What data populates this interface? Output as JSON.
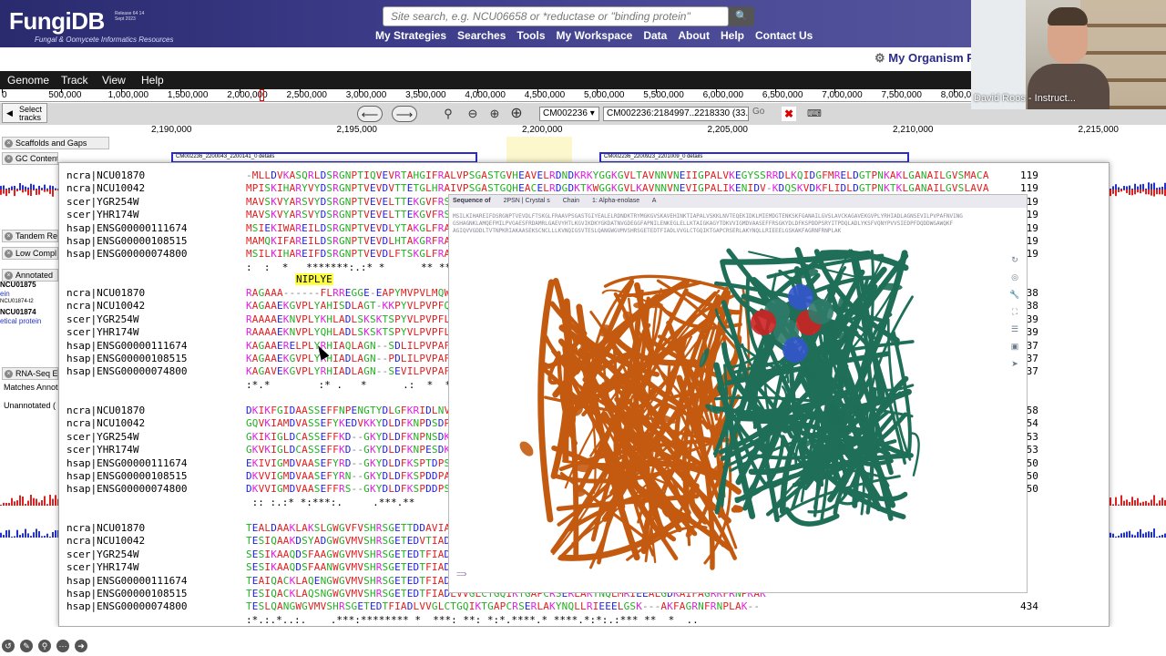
{
  "app": {
    "name": "FungiDB",
    "subtitle": "Fungal & Oomycete Informatics Resources",
    "release": "Release 64 14 Sept 2023"
  },
  "search": {
    "placeholder": "Site search, e.g. NCU06658 or *reductase or \"binding protein\""
  },
  "nav": [
    "My Strategies",
    "Searches",
    "Tools",
    "My Workspace",
    "Data",
    "About",
    "Help",
    "Contact Us"
  ],
  "my_organism": "My Organism P",
  "video": {
    "presenter": "David Roos - Instruct..."
  },
  "browser": {
    "menu": [
      "Genome",
      "Track",
      "View",
      "Help"
    ],
    "ruler": [
      "0",
      "500,000",
      "1,000,000",
      "1,500,000",
      "2,000,000",
      "2,500,000",
      "3,000,000",
      "3,500,000",
      "4,000,000",
      "4,500,000",
      "5,000,000",
      "5,500,000",
      "6,000,000",
      "6,500,000",
      "7,000,000",
      "7,500,000",
      "8,000,000"
    ],
    "select_tracks": "Select tracks",
    "ref_seq": "CM002236",
    "location": "CM002236:2184997..2218330 (33.33 Kb)",
    "go": "Go",
    "coords": [
      "2,190,000",
      "2,195,000",
      "2,200,000",
      "2,205,000",
      "2,210,000",
      "2,215,000"
    ],
    "tracks": [
      "Scaffolds and Gaps",
      "GC Content",
      "Tandem Re",
      "Low Compl",
      "Annotated",
      "RNA-Seq Ev",
      "Matches Annot",
      "Unannotated ("
    ],
    "features": [
      "CM002236_2200043_2200141_0 details",
      "CM002236_2200923_2201009_0 details"
    ],
    "gene_labels": [
      "NCU01875",
      "ein",
      "NCU01874-t2",
      "NCU01874",
      "etical protein"
    ]
  },
  "alignment": {
    "motif": "NIPLYE",
    "blocks": [
      {
        "rows": [
          {
            "name": "ncra|NCU01870",
            "seq": "-MLLDVKASQRLDSRGNPTIQVEVRTAHGIFRALVPSGASTGVHEAVELRDNDKRKYGGKGVLTAVNNVNEIIGPALVKEGYSSRRDLKQIDGFMRELDGTPNKAKLGANAILGVSMACA",
            "num": "119"
          },
          {
            "name": "ncra|NCU10042",
            "seq": "MPISKIHARYVYDSRGNPTVEVDVTTETGLHRAIVPSGASTGQHEACELRDGDKTKWGGKGVLKAVNNVNEVIGPALIKENIDV-KDQSKVDKFLIDLDGTPNKTKLGANAILGVSLAVA",
            "num": "119"
          },
          {
            "name": "scer|YGR254W",
            "seq": "MAVSKVYARSVYDSRGNPTVEVELTTEKGVFRSIVPSGASTGVHEALEMRDEDKSKWMGKGVMNAVNNVNNVIAAAFVKANLDVKDQKAVDDFLLSLDGTANKSKLGANAILGVSLAAS",
            "num": "119"
          },
          {
            "name": "scer|YHR174W",
            "seq": "MAVSKVYARSVYDSRGNPTVEVELTTEKGVFRSIVPSGASTGVHEALEMRDGDKSKWMGKGVLHAVKNVNDVIAPAFVKANIDVKDQKAVDDFLISLDGTANKSKLGANAILGVSMAAA",
            "num": "119"
          },
          {
            "name": "hsap|ENSG00000111674",
            "seq": "MSIEKIWAREILDSRGNPTVEVDLYTAKGLFRAAVPSGASTGIYEALELRDGDKQRYLGKGVLKAVDHINSTIAPALISSGLSVVEQEKLDNLMLELDGTENKSKFGANAILGVSLAVC",
            "num": "119"
          },
          {
            "name": "hsap|ENSG00000108515",
            "seq": "MAMQKIFAREILDSRGNPTVEVDLHTAKGRFRAAVPSGASTGIYEALELRDGDKGRYLGKGVLKAVENINNTLGPALLQKKLSVVDQEKVDKFMIELDGTENKSKFGANAILGVSLAVC",
            "num": "119"
          },
          {
            "name": "hsap|ENSG00000074800",
            "seq": "MSILKIHAREIFDSRGNPTVEVDLFTSKGLFRAAVPSGASTGIYEALELRDNDKTRYMGKGVSKAVEHINKTIAPALVSKKLNVTEQEKIDKLMIEMDGTENKSKFGANAILGVSLAVC",
            "num": "119"
          }
        ],
        "cons": ":  :  *   *******:.:* *      ** **********  ** * ***  *   *** ** *   * *   *    *  .  *  *****.* *.* *********  *"
      },
      {
        "rows": [
          {
            "name": "ncra|NCU01870",
            "seq": "RAGAAA------FLRREGGE-EAPYMVPVLMQWKVKLGSIAIGEVAARGGTLALDVTDAGKLKPEEAARLGSFKPTKAKAGYT",
            "num": "238"
          },
          {
            "name": "ncra|NCU10042",
            "seq": "KAGAAEKGVPLYAHISDLAGT-KKPYVLPVPFQNVLNGGSHAGGRLAFQEFMIVPDAGKLKAAKVAKIPEFFNLKAKAGYT",
            "num": "238"
          },
          {
            "name": "scer|YGR254W",
            "seq": "RAAAAEKNVPLYKHLADLSKSKTSPYVLPVPFLNVLNGGSHAGGALALQEFMIAPTGAKTFAEALRIGSEVYHNLKSLTKAAGHD",
            "num": "239"
          },
          {
            "name": "scer|YHR174W",
            "seq": "RAAAAEKNVPLYQHLADLSKSKTSPYVLPVPFLNVLNGGSHAGGALALQEFMIAPTGAKTFAEAMRIGSEVYHNLKSLTKAAGHD",
            "num": "239"
          },
          {
            "name": "hsap|ENSG00000111674",
            "seq": "KAGAAERELPLYRHIAQLAGN--SDLILPVPAFNVINGGSHAGNKLAMQEFMILPVGAANFREAMRIGAEVYHNLKNVIKEKDKYT",
            "num": "237"
          },
          {
            "name": "hsap|ENSG00000108515",
            "seq": "KAGAAEKGVPLYRHIADLAGN--PDLILPVPAFNVINGGSHAGNKLAMQEFMILPVGASSFKEAMRIGAEVYHHLKGVIKAQAGYT",
            "num": "237"
          },
          {
            "name": "hsap|ENSG00000074800",
            "seq": "KAGAVEKGVPLYRHIADLAGN--SEVILPVPAFNVINGGSHAGNKLAMQEFMILPVGAESFRDAMRLGAEVYHTLKGVIKDKAGYT",
            "num": "237"
          }
        ],
        "cons": ":*.*        :* .   *      .:  *  *   *:**** *  **  * *  *  . *  *   *    *        .    *:*:"
      },
      {
        "rows": [
          {
            "name": "ncra|NCU01870",
            "seq": "DKIKFGIDAASSEFFNPENGTYDLGFKRIDLNVRLPFCLTYFFTPGWEETWIQEFLHRNETHLGQKSVQIVGDDLTVTNPQIGTV",
            "num": "358"
          },
          {
            "name": "ncra|NCU10042",
            "seq": "GQVKIAMDVASSEFYKEDVKKYDLDFKNPDSDPSKWLTGVELADLYHSLMKRYPIVSIEDPFAEDDWEAWSHFFKTAGIQIVADDLTVTNPKRIATAIEKKAANALLLKVNQIGTL",
            "num": "354"
          },
          {
            "name": "scer|YGR254W",
            "seq": "GKIKIGLDCASSEFFKD--GKYDLDFKNPNSDKSKWLTGPQLADLYHSLMKRYPIVSIEDPFAEDDWEAWSHFFKTAGIQIVADDLTVTNPKRIATAIEKKAADALLLKVNQIGTL",
            "num": "353"
          },
          {
            "name": "scer|YHR174W",
            "seq": "GKVKIGLDCASSEFFKD--GKYDLDFKNPESDKSKWLTGVELADMYHSLMKRYPIVSIEDPFAEDDWEAWSHFFKTAGIQIVADDLTVTNPARIATAIEKKAADALLLKVNQIGTL",
            "num": "353"
          },
          {
            "name": "hsap|ENSG00000111674",
            "seq": "EKIVIGMDVAASEFYRD--GKYDLDFKSPTDPSRYITGDQLGALYQDFVRDYPVVSIEDPFDQDDWAAWSKFTANVGIQIVGDDLTVTNPKRIERAVEEKACNCLLLKVNQIGSV",
            "num": "350"
          },
          {
            "name": "hsap|ENSG00000108515",
            "seq": "DKVVIGMDVAASEFYRN--GKYDLDFKSPDDPARHITGEKLGELYKSFIKNYPVVSIEDPFDQDDWATWTSFLSGVNIQIVGDDLTVTNPKRIAQAVEKKACNCLLLKVNQIGSV",
            "num": "350"
          },
          {
            "name": "hsap|ENSG00000074800",
            "seq": "DKVVIGMDVAASEFFRS--GKYDLDFKSPDDPSRYITPDQLADLYKSFVQNYPVVSIEDPFDQDDWGAWQKFTASAGIQVVGDDLTVTNPKRIAKAASEKSCNCLLLKVNQIGSV",
            "num": "350"
          }
        ],
        "cons": " :: :.:* *:***:.     .***.**       *    *    * *       * * *     **   * *  *  *  *  ****.*****  *    *       *:::*:**:"
      },
      {
        "rows": [
          {
            "name": "ncra|NCU01870",
            "seq": "TEALDAAKLAKSLGWGVFVSHRSGETTDDAVIADIVVGLRAGQIKTGAPCRSERLAKLNQILRIEEELGDNAVYAGKNFHKAHKL",
            "num": ""
          },
          {
            "name": "ncra|NCU10042",
            "seq": "TESIQAAKDSYADGWGVMVSHRSGETEDVTIADIAVGLRAGQIKTGAPARSERLAKLNQILRIEEELGDNAVYAGNNFRTAVNL",
            "num": ""
          },
          {
            "name": "scer|YGR254W",
            "seq": "SESIKAAQDSFAAGWGVMVSHRSGETEDTFIADLVVGLRTGQIKTGAPARSERLAKLNQLLRIEEELGDNAVFAGENFHHGDKL",
            "num": ""
          },
          {
            "name": "scer|YHR174W",
            "seq": "SESIKAAQDSFAANWGVMVSHRSGETEDTFIADLVVGLRTGQIKTGAPARSERLAKLNQLLRIEEELGDKAVYAGENFHHGDKL",
            "num": ""
          },
          {
            "name": "hsap|ENSG00000111674",
            "seq": "TEAIQACKLAQENGWGVMVSHRSGETEDTFIADLVVGLCTGQIKTGAPCRSERLAKYNQLLRIEEELGSKAKFAGRNFRNPLAK",
            "num": ""
          },
          {
            "name": "hsap|ENSG00000108515",
            "seq": "TESIQACKLAQSNGWGVMVSHRSGETEDTFIADLVVGLCTGQIKTGAPCRSERLAKYNQLMRIEEALGDKAIFAGRKFRNPKAK",
            "num": ""
          },
          {
            "name": "hsap|ENSG00000074800",
            "seq": "TESLQANGWGVMVSHRSGETEDTFIADLVVGLCTGQIKTGAPCRSERLAKYNQLLRIEEELGSK---AKFAGRNFRNPLAK--",
            "num": "434"
          }
        ],
        "cons": ":*.:.*..:.    .***:******** *  ***: **: *:*.****.* ****.*:*:.:*** **  *  .."
      }
    ]
  },
  "structure": {
    "toolbar": [
      "Sequence of",
      "2PSN | Crystal s",
      "Chain",
      "1: Alpha-enolase",
      "A"
    ],
    "seq_lines": [
      "MSILKIHAREIFDSRGNPTVEVDLFTSKGLFRAAVPSGASTGIYEALELRDNDKTRYMGKGVSKAVEHINKTIAPALVSKKLNVTEQEKIDKLMIEMDGTENKSKFGANAILGVSLAVCKAGAVEKGVPLYRHIADLAGNSEVILPVPAFNVING",
      "GSHAGNKLAMQEFMILPVGAESFRDAMRLGAEVYHTLKGVIKDKYGKDATNVGDEGGFAPNILENKEGLELLKTAIGKAGYTDKVVIGMDVAASEFFRSGKYDLDFKSPDDPSRYITPDQLADLYKSFVQNYPVVSIEDPFDQDDWGAWQKF",
      "AGIQVVGDDLTVTNPKRIAKAASEKSCNCLLLKVNQIGSVTESLQANGWGVMVSHRSGETEDTFIADLVVGLCTGQIKTGAPCRSERLAKYNQLLRIEEELGSKAKFAGRNFRNPLAK"
    ]
  },
  "colors": {
    "hydrophobic": "#e02020",
    "acidic": "#2020e0",
    "basic": "#e020e0",
    "polar": "#20b020",
    "other": "#808080",
    "chain_a": "#c45a10",
    "chain_b": "#1e6e58"
  }
}
